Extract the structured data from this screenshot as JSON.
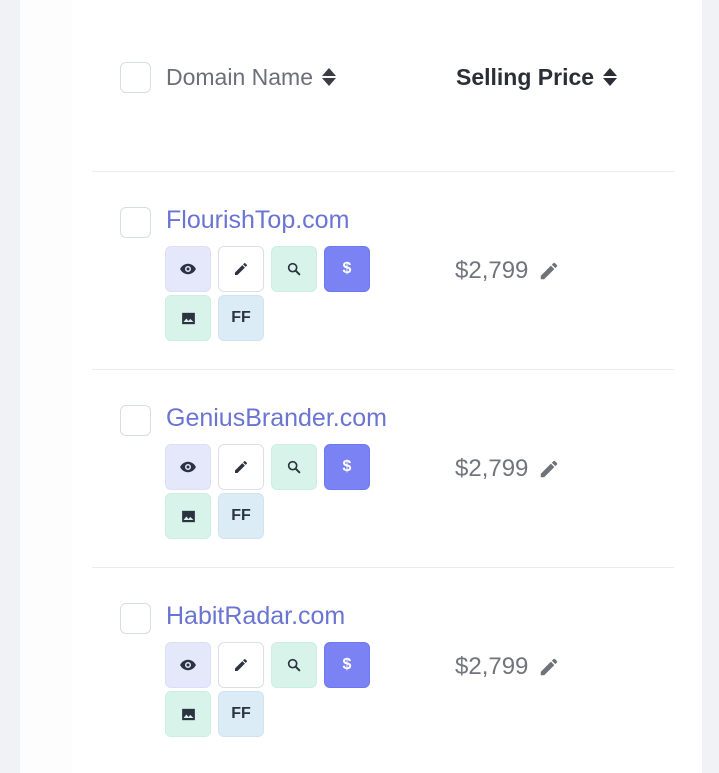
{
  "table": {
    "header": {
      "domain_label": "Domain Name",
      "price_label": "Selling Price"
    },
    "rows": [
      {
        "domain": "FlourishTop.com",
        "price": "$2,799",
        "price_button": "$",
        "ff_button": "FF"
      },
      {
        "domain": "GeniusBrander.com",
        "price": "$2,799",
        "price_button": "$",
        "ff_button": "FF"
      },
      {
        "domain": "HabitRadar.com",
        "price": "$2,799",
        "price_button": "$",
        "ff_button": "FF"
      }
    ]
  },
  "icons": {
    "view": "eye-icon",
    "edit": "pencil-icon",
    "search": "magnifier-icon",
    "image": "image-icon",
    "sort": "sort-icon"
  },
  "colors": {
    "accent": "#7b82f4",
    "link": "#6a74d2",
    "mint": "#d7f3ea",
    "lavender": "#e5e7fb",
    "sky": "#dcecf7"
  }
}
